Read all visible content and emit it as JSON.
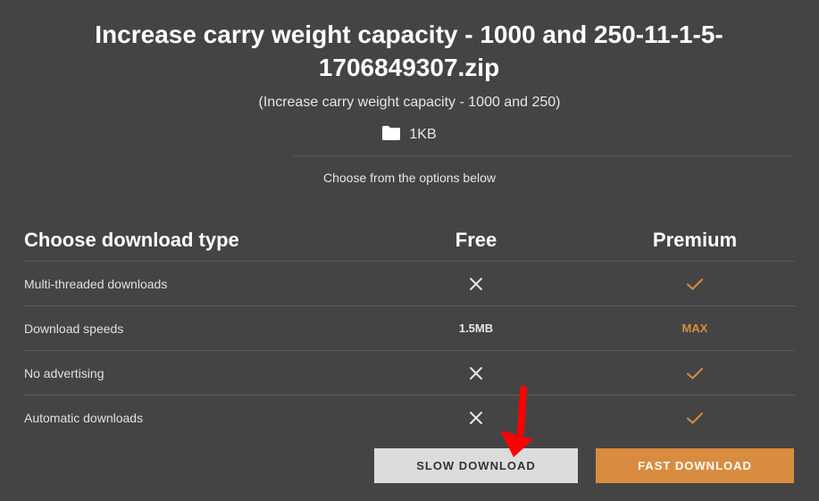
{
  "file": {
    "title": "Increase carry weight capacity - 1000 and 250-11-1-5-1706849307.zip",
    "subtitle": "(Increase carry weight capacity - 1000 and 250)",
    "size": "1KB",
    "size_icon": "folder-icon"
  },
  "instruction": "Choose from the options below",
  "table": {
    "header": {
      "label": "Choose download type",
      "free": "Free",
      "premium": "Premium"
    },
    "rows": [
      {
        "label": "Multi-threaded downloads",
        "free": "cross-icon",
        "premium": "check-icon"
      },
      {
        "label": "Download speeds",
        "free": "1.5MB",
        "premium": "MAX"
      },
      {
        "label": "No advertising",
        "free": "cross-icon",
        "premium": "check-icon"
      },
      {
        "label": "Automatic downloads",
        "free": "cross-icon",
        "premium": "check-icon"
      }
    ]
  },
  "buttons": {
    "slow": "SLOW DOWNLOAD",
    "fast": "FAST DOWNLOAD"
  },
  "annotation": {
    "arrow_icon": "red-arrow-down-icon",
    "arrow_color": "#ff0000"
  },
  "colors": {
    "background": "#444444",
    "accent": "#d98c3f",
    "slow_button": "#dcdcdc"
  }
}
